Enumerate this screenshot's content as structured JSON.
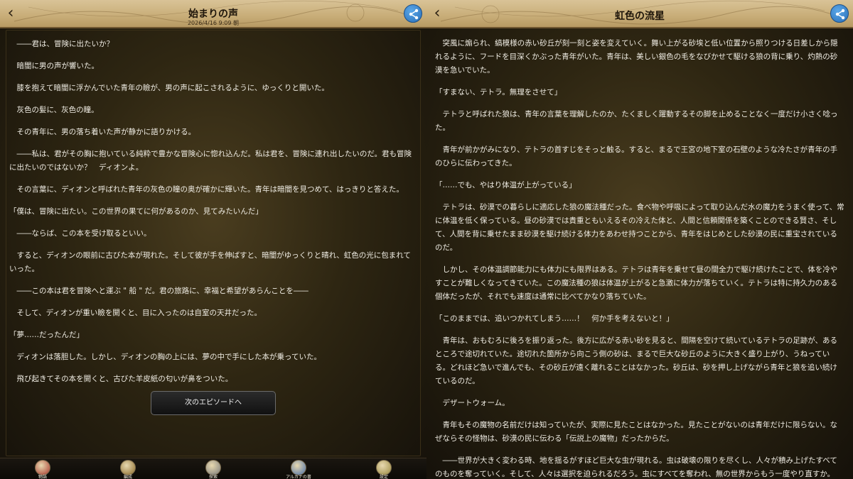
{
  "left": {
    "title": "始まりの声",
    "subtitle": "2026/4/16 9:09 朝",
    "paragraphs": [
      {
        "text": "――君は、冒険に出たいか？",
        "dialog": false
      },
      {
        "text": "暗闇に男の声が響いた。",
        "dialog": false
      },
      {
        "text": "膝を抱えて暗闇に浮かんでいた青年の瞼が、男の声に起こされるように、ゆっくりと開いた。",
        "dialog": false
      },
      {
        "text": "灰色の髪に、灰色の瞳。",
        "dialog": false
      },
      {
        "text": "その青年に、男の落ち着いた声が静かに語りかける。",
        "dialog": false
      },
      {
        "text": "――私は、君がその胸に抱いている純粋で豊かな冒険心に惚れ込んだ。私は君を、冒険に連れ出したいのだ。君も冒険に出たいのではないか？　ディオンよ。",
        "dialog": false
      },
      {
        "text": "その言葉に、ディオンと呼ばれた青年の灰色の瞳の奥が確かに輝いた。青年は暗闇を見つめて、はっきりと答えた。",
        "dialog": false
      },
      {
        "text": "「僕は、冒険に出たい。この世界の果てに何があるのか、見てみたいんだ」",
        "dialog": true
      },
      {
        "text": "――ならば、この本を受け取るといい。",
        "dialog": false
      },
      {
        "text": "すると、ディオンの眼前に古びた本が現れた。そして彼が手を伸ばすと、暗闇がゆっくりと晴れ、虹色の光に包まれていった。",
        "dialog": false
      },
      {
        "text": "――この本は君を冒険へと運ぶ \" 船 \" だ。君の旅路に、幸福と希望があらんことを――",
        "dialog": false
      },
      {
        "text": "そして、ディオンが重い瞼を開くと、目に入ったのは自室の天井だった。",
        "dialog": false
      },
      {
        "text": "「夢……だったんだ」",
        "dialog": true
      },
      {
        "text": "ディオンは落胆した。しかし、ディオンの胸の上には、夢の中で手にした本が乗っていた。",
        "dialog": false
      },
      {
        "text": "飛び起きてその本を開くと、古びた羊皮紙の匂いが鼻をついた。",
        "dialog": false
      }
    ],
    "next_label": "次のエピソードへ",
    "nav": [
      {
        "label": "物語",
        "icon": "story-icon",
        "color": "#a8362b"
      },
      {
        "label": "編成",
        "icon": "party-icon",
        "color": "#8a6a2a"
      },
      {
        "label": "探索",
        "icon": "explore-icon",
        "color": "#7a7a7a"
      },
      {
        "label": "アルカナの書",
        "icon": "arcana-book-icon",
        "color": "#4a6fa8"
      },
      {
        "label": "設定",
        "icon": "gear-icon",
        "color": "#9a8a40"
      }
    ]
  },
  "right": {
    "title": "虹色の流星",
    "paragraphs": [
      {
        "text": "突風に煽られ、縞模様の赤い砂丘が刻一刻と姿を変えていく。舞い上がる砂埃と低い位置から照りつける日差しから隠れるように、フードを目深くかぶった青年がいた。青年は、美しい銀色の毛をなびかせて駆ける狼の背に乗り、灼熱の砂漠を急いでいた。",
        "dialog": false
      },
      {
        "text": "「すまない、テトラ。無理をさせて」",
        "dialog": true
      },
      {
        "text": "テトラと呼ばれた狼は、青年の言葉を理解したのか、たくましく躍動するその脚を止めることなく一度だけ小さく唸った。",
        "dialog": false
      },
      {
        "text": "青年が前かがみになり、テトラの首すじをそっと触る。すると、まるで王宮の地下室の石壁のような冷たさが青年の手のひらに伝わってきた。",
        "dialog": false
      },
      {
        "text": "「……でも、やはり体温が上がっている」",
        "dialog": true
      },
      {
        "text": "テトラは、砂漠での暮らしに適応した狼の魔法種だった。食べ物や呼吸によって取り込んだ水の魔力をうまく使って、常に体温を低く保っている。昼の砂漠では貴重ともいえるその冷えた体と、人間と信頼関係を築くことのできる賢さ、そして、人間を背に乗せたまま砂漠を駆け続ける体力をあわせ持つことから、青年をはじめとした砂漠の民に重宝されているのだ。",
        "dialog": false
      },
      {
        "text": "しかし、その体温調節能力にも体力にも限界はある。テトラは青年を乗せて昼の間全力で駆け続けたことで、体を冷やすことが難しくなってきていた。この魔法種の狼は体温が上がると急激に体力が落ちていく。テトラは特に持久力のある個体だったが、それでも速度は通常に比べてかなり落ちていた。",
        "dialog": false
      },
      {
        "text": "「このままでは、追いつかれてしまう……！　何か手を考えないと！」",
        "dialog": true
      },
      {
        "text": "青年は、おもむろに後ろを振り返った。後方に広がる赤い砂を見ると、間隔を空けて続いているテトラの足跡が、あるところで途切れていた。途切れた箇所から向こう側の砂は、まるで巨大な砂丘のように大きく盛り上がり、うねっている。どれほど急いで進んでも、その砂丘が遠く離れることはなかった。砂丘は、砂を押し上げながら青年と狼を追い続けているのだ。",
        "dialog": false
      },
      {
        "text": "デザートウォーム。",
        "dialog": false
      },
      {
        "text": "青年もその魔物の名前だけは知っていたが、実際に見たことはなかった。見たことがないのは青年だけに限らない。なぜならその怪物は、砂漠の民に伝わる「伝説上の魔物」だったからだ。",
        "dialog": false
      },
      {
        "text": "――世界が大きく変わる時、地を揺るがすほど巨大な虫が現れる。虫は破壊の限りを尽くし、人々が積み上げたすべてのものを奪っていく。そして、人々は選択を迫られるだろう。虫にすべてを奪われ、無の世界からもう一度やり直すか。",
        "dialog": false
      }
    ]
  }
}
